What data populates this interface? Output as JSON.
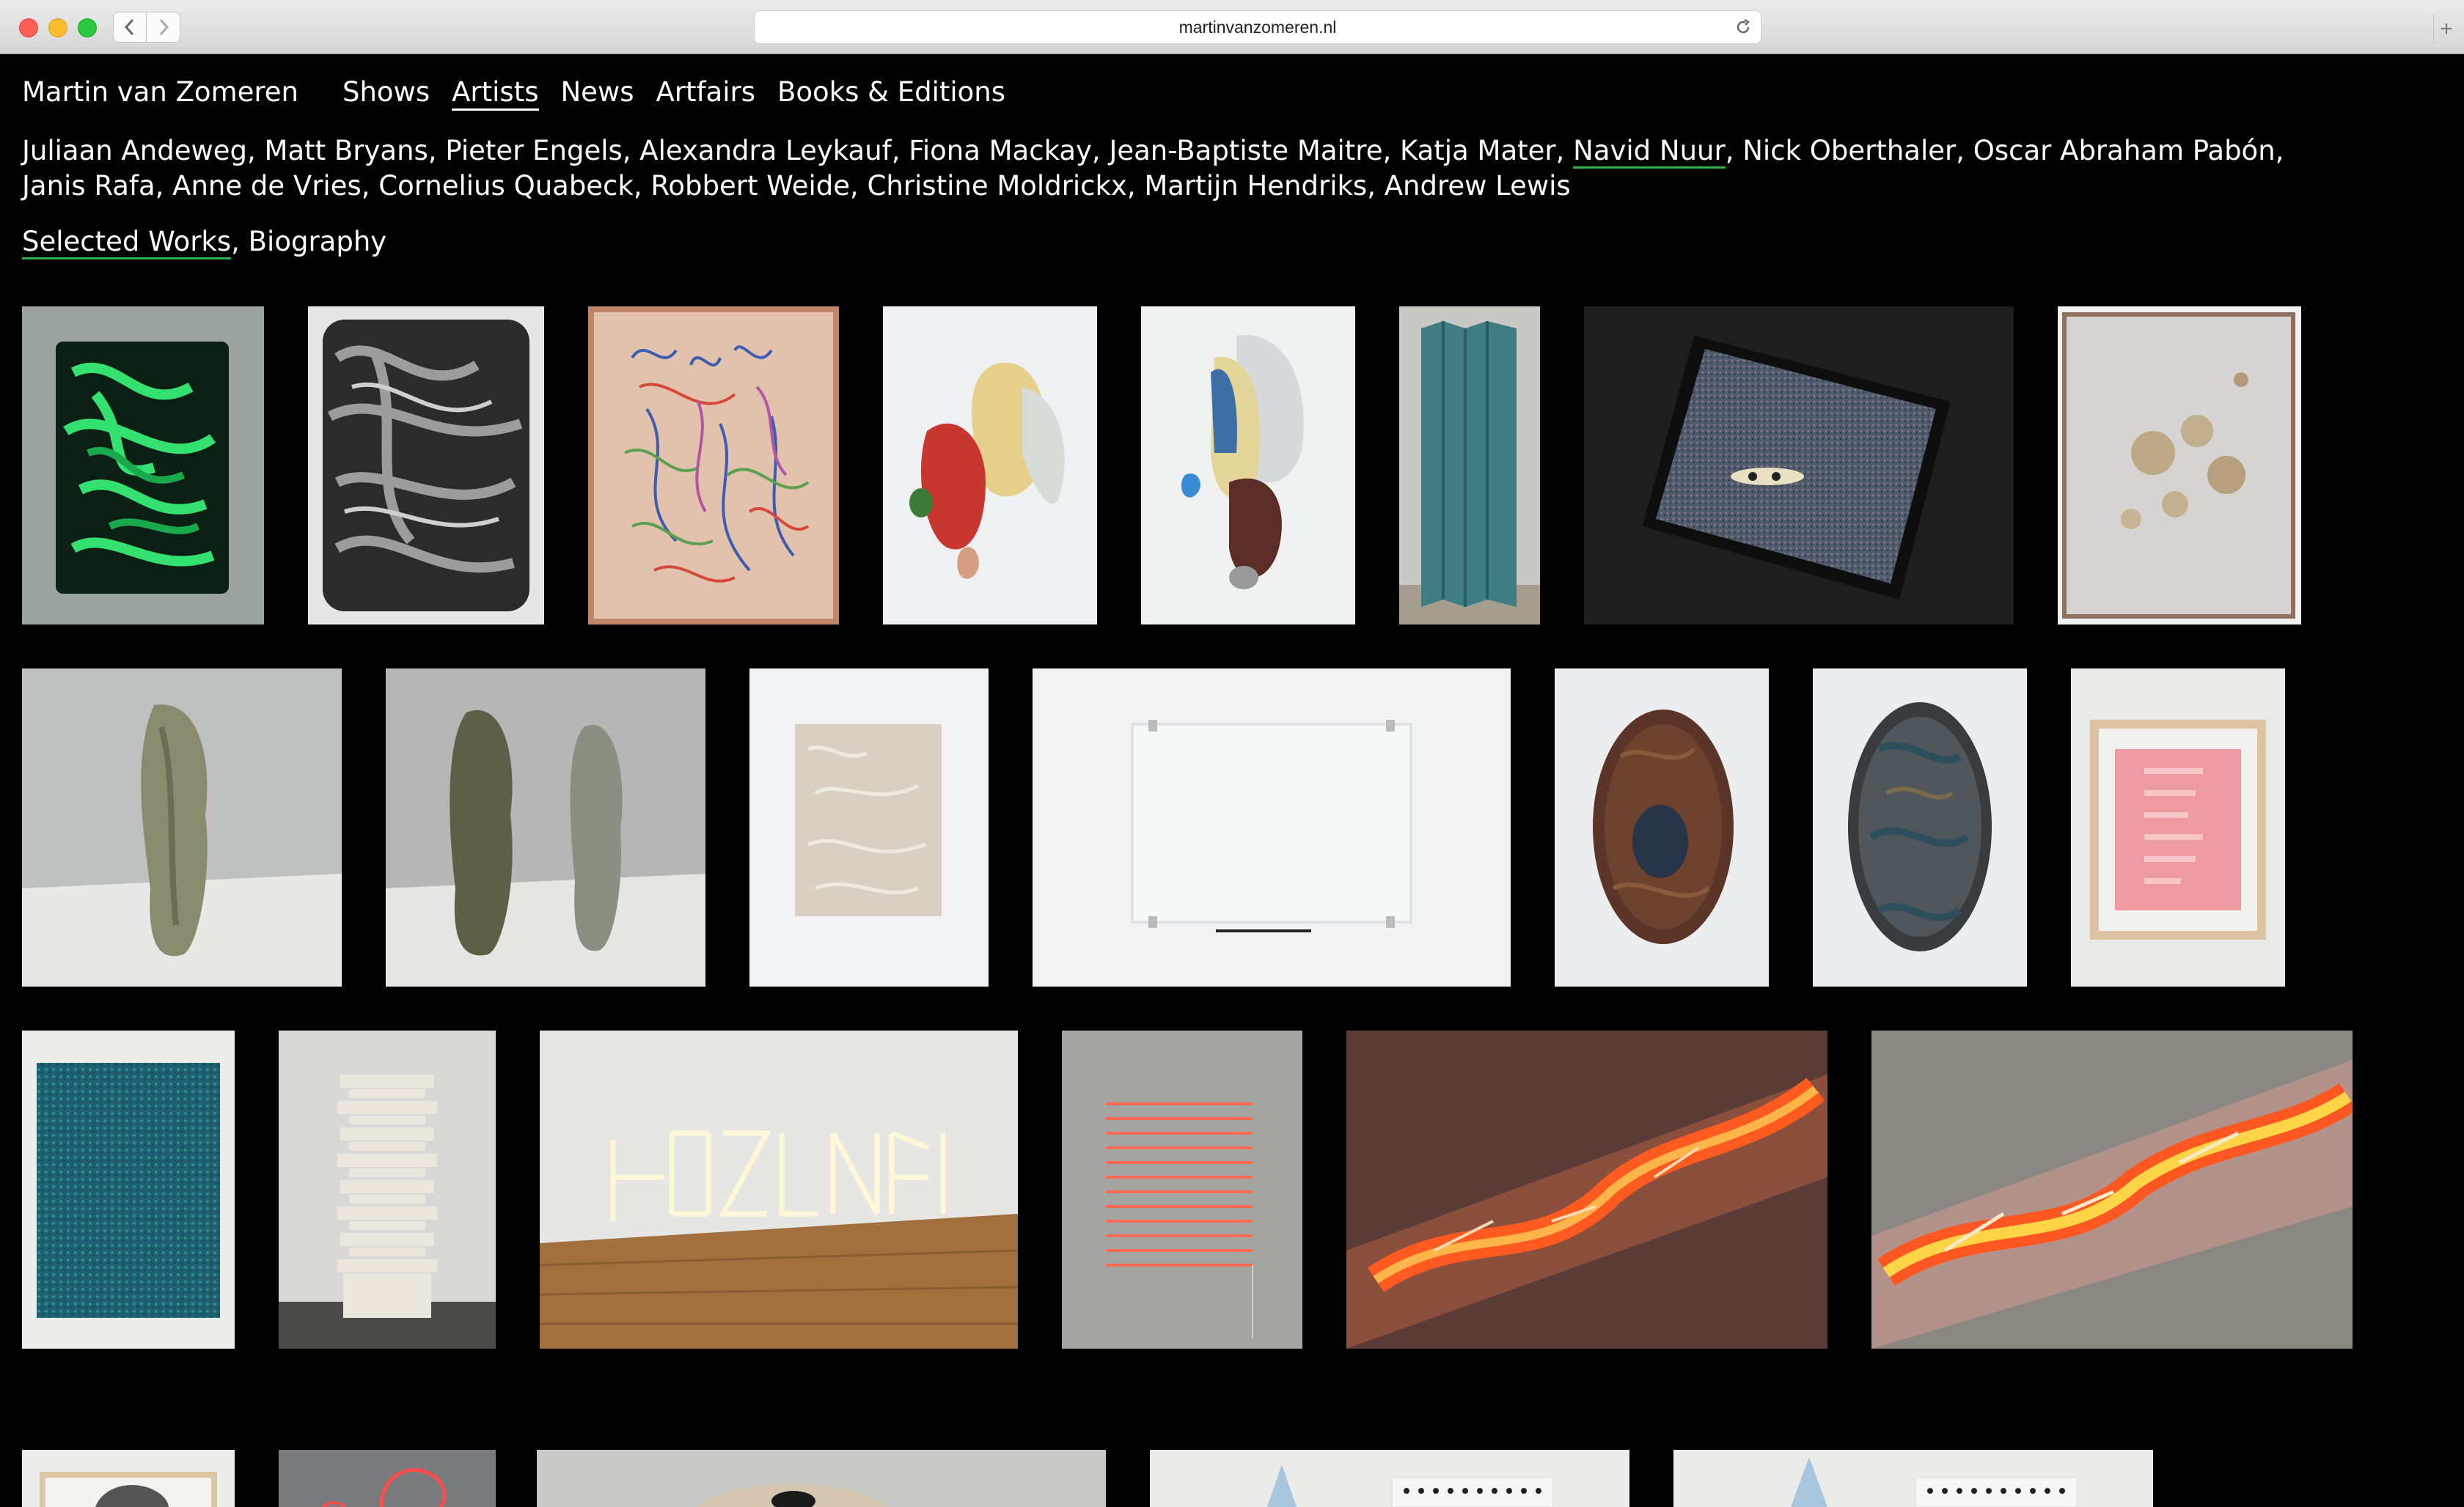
{
  "browser": {
    "url": "martinvanzomeren.nl",
    "back_icon": "chevron-left-icon",
    "forward_icon": "chevron-right-icon",
    "reload_icon": "reload-icon",
    "new_tab_label": "+"
  },
  "nav": {
    "brand": "Martin van Zomeren",
    "items": [
      "Shows",
      "Artists",
      "News",
      "Artfairs",
      "Books & Editions"
    ],
    "active": "Artists"
  },
  "artists": {
    "list": [
      "Juliaan Andeweg",
      "Matt Bryans",
      "Pieter Engels",
      "Alexandra Leykauf",
      "Fiona Mackay",
      "Jean-Baptiste Maitre",
      "Katja Mater",
      "Navid Nuur",
      "Nick Oberthaler",
      "Oscar Abraham Pabón",
      "Janis Rafa",
      "Anne de Vries",
      "Cornelius Quabeck",
      "Robbert Weide",
      "Christine Moldrickx",
      "Martijn Hendriks",
      "Andrew Lewis"
    ],
    "selected": "Navid Nuur",
    "separator": ", "
  },
  "subnav": {
    "items": [
      "Selected Works",
      "Biography"
    ],
    "selected": "Selected Works",
    "separator": ", "
  },
  "colors": {
    "background": "#000000",
    "text": "#ffffff",
    "selected_underline": "#2fb34a"
  },
  "artworks": [
    "green-marbled-panel",
    "grey-marbled-panel",
    "pastel-line-drawing",
    "colored-stone-sculpture-1",
    "colored-stone-sculpture-2",
    "folded-teal-column",
    "speckled-tray-with-objects",
    "stained-canvas",
    "ceramic-column-1",
    "ceramic-columns-pair",
    "white-textured-canvas",
    "glass-panel-on-wall",
    "ceramic-slab-1",
    "ceramic-slab-2",
    "pink-text-print",
    "blue-dotted-canvas",
    "stacked-stone-tower",
    "neon-letters-installation",
    "red-neon-lines",
    "glowing-glass-tube-1",
    "glowing-glass-tube-2",
    "framed-hands-photo",
    "red-neon-curve",
    "rock-sculpture",
    "ice-tower-and-dot-grid-1",
    "ice-tower-and-dot-grid-2"
  ]
}
